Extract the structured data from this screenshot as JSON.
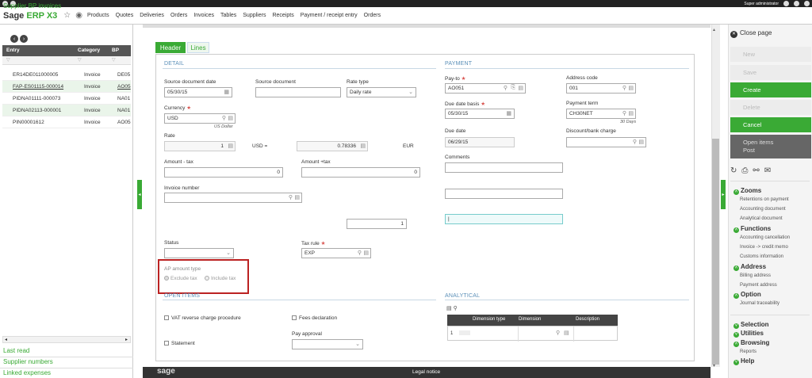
{
  "menubar": {
    "logo_main": "Sage ",
    "logo_accent": "ERP X3",
    "items": [
      "Products",
      "Quotes",
      "Deliveries",
      "Orders",
      "Invoices",
      "Tables",
      "Suppliers",
      "Receipts",
      "Payment / receipt entry",
      "Orders"
    ],
    "user": "Super administrator"
  },
  "left": {
    "title": "Supplier BP invoices",
    "columns": [
      "Entry",
      "Category",
      "BP"
    ],
    "rows": [
      {
        "entry": "ER14DE011000005",
        "category": "Invoice",
        "bp": "DE05"
      },
      {
        "entry": "FAP-ES01115-000014",
        "category": "Invoice",
        "bp": "AO05"
      },
      {
        "entry": "PIDNA01111-000073",
        "category": "Invoice",
        "bp": "NA01"
      },
      {
        "entry": "PIDNA02113-000001",
        "category": "Invoice",
        "bp": "NA01"
      },
      {
        "entry": "PIN00001612",
        "category": "Invoice",
        "bp": "AO05"
      }
    ],
    "links": [
      "Last read",
      "Supplier numbers",
      "Linked expenses"
    ]
  },
  "tabs": {
    "header": "Header",
    "lines": "Lines"
  },
  "detail": {
    "section": "DETAIL",
    "source_doc_date_label": "Source document date",
    "source_doc_date": "05/30/15",
    "source_doc_label": "Source document",
    "source_doc": "",
    "rate_type_label": "Rate type",
    "rate_type": "Daily rate",
    "currency_label": "Currency",
    "currency": "USD",
    "currency_sub": "US Dollar",
    "rate_label": "Rate",
    "rate_value1": "1",
    "rate_mid": "USD =",
    "rate_value2": "0.78336",
    "rate_eur": "EUR",
    "amount_tax_label": "Amount - tax",
    "amount_tax": "0",
    "amount_plus_label": "Amount +tax",
    "amount_plus": "0",
    "invoice_number_label": "Invoice number",
    "invoice_number": "",
    "count_value": "1",
    "status_label": "Status",
    "status": "",
    "tax_rule_label": "Tax rule",
    "tax_rule": "EXP",
    "ap_amount_type_label": "AP amount type",
    "exclude_tax": "Exclude tax",
    "include_tax": "Include tax"
  },
  "payment": {
    "section": "PAYMENT",
    "pay_to_label": "Pay-to",
    "pay_to": "AO051",
    "address_code_label": "Address code",
    "address_code": "001",
    "due_date_basis_label": "Due date basis",
    "due_date_basis": "05/30/15",
    "payment_term_label": "Payment term",
    "payment_term": "CH30NET",
    "payment_term_sub": "30 Days",
    "due_date_label": "Due date",
    "due_date": "06/29/15",
    "discount_label": "Discount/bank charge",
    "discount": "",
    "comments_label": "Comments"
  },
  "open_items": {
    "section": "OPEN ITEMS",
    "vat_reverse": "VAT reverse charge procedure",
    "fees_declaration": "Fees declaration",
    "pay_approval_label": "Pay approval",
    "statement": "Statement"
  },
  "analytical": {
    "section": "ANALYTICAL",
    "columns": [
      "Dimension type",
      "Dimension",
      "Description"
    ],
    "row_num": "1"
  },
  "footer": {
    "logo": "sage",
    "legal": "Legal notice"
  },
  "right": {
    "close": "Close page",
    "buttons": [
      "New",
      "Save",
      "Create",
      "Delete",
      "Cancel"
    ],
    "open_items": "Open items",
    "post": "Post",
    "zooms": "Zooms",
    "zoom_items": [
      "Retentions on payment",
      "Accounting document",
      "Analytical document"
    ],
    "functions": "Functions",
    "function_items": [
      "Accounting cancellation",
      "Invoice -> credit memo",
      "Customs information"
    ],
    "address": "Address",
    "address_items": [
      "Billing address",
      "Payment address"
    ],
    "option": "Option",
    "option_items": [
      "Journal traceability"
    ],
    "selection": "Selection",
    "utilities": "Utilities",
    "browsing": "Browsing",
    "browsing_items": [
      "Reports"
    ],
    "help": "Help"
  }
}
